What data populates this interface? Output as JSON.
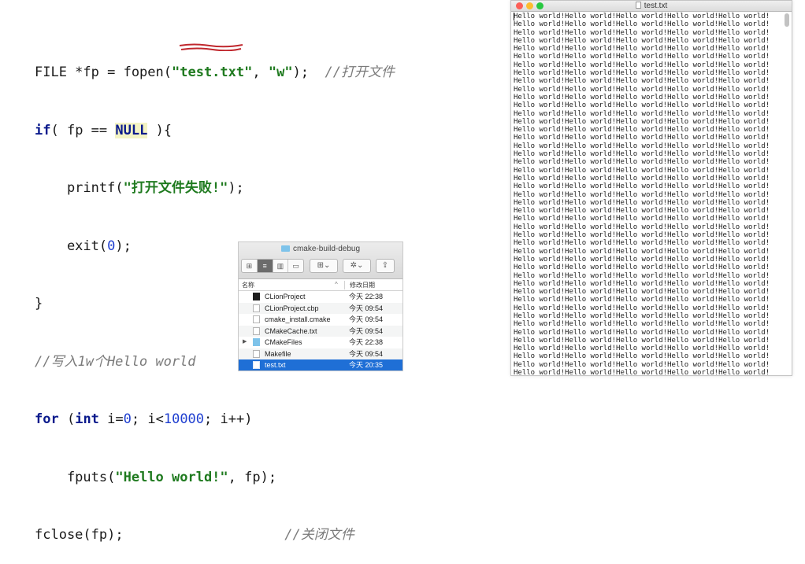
{
  "code": {
    "l1_pre": "FILE *fp = fopen(",
    "l1_file": "\"test.txt\"",
    "l1_mid": ", ",
    "l1_mode": "\"w\"",
    "l1_post": ");  ",
    "l1_comment": "//打开文件",
    "l2_if": "if",
    "l2_a": "( fp == ",
    "l2_null": "NULL",
    "l2_b": " ){",
    "l3_a": "    printf(",
    "l3_str": "\"打开文件失败!\"",
    "l3_b": ");",
    "l4_a": "    exit(",
    "l4_num": "0",
    "l4_b": ");",
    "l5": "}",
    "l6_comment": "//写入1w个Hello world",
    "l7_for": "for",
    "l7_a": " (",
    "l7_int": "int",
    "l7_b": " i=",
    "l7_zero": "0",
    "l7_c": "; i<",
    "l7_max": "10000",
    "l7_d": "; i++)",
    "l8_a": "    fputs(",
    "l8_str": "\"Hello world!\"",
    "l8_b": ", fp);",
    "l9_a": "fclose(fp);                    ",
    "l9_comment": "//关闭文件"
  },
  "finder": {
    "title": "cmake-build-debug",
    "view_buttons": [
      "⊞",
      "≡",
      "▥",
      "▭"
    ],
    "arrange_label": "⊞⌄",
    "action_label": "✲⌄",
    "share_label": "⇪",
    "col_name": "名称",
    "col_sort": "^",
    "col_date": "修改日期",
    "rows": [
      {
        "name": "CLionProject",
        "date": "今天 22:38",
        "icon": "executable-icon",
        "disclosure": ""
      },
      {
        "name": "CLionProject.cbp",
        "date": "今天 09:54",
        "icon": "document-icon",
        "disclosure": ""
      },
      {
        "name": "cmake_install.cmake",
        "date": "今天 09:54",
        "icon": "document-icon",
        "disclosure": ""
      },
      {
        "name": "CMakeCache.txt",
        "date": "今天 09:54",
        "icon": "document-icon",
        "disclosure": ""
      },
      {
        "name": "CMakeFiles",
        "date": "今天 22:38",
        "icon": "folder-icon",
        "disclosure": "▶"
      },
      {
        "name": "Makefile",
        "date": "今天 09:54",
        "icon": "document-icon",
        "disclosure": ""
      },
      {
        "name": "test.txt",
        "date": "今天 20:35",
        "icon": "document-icon",
        "disclosure": ""
      }
    ],
    "selected_row": "test.txt"
  },
  "textedit": {
    "title": "test.txt",
    "repeat_text": "Hello world!",
    "visible_lines": 46,
    "per_line": 5
  },
  "colors": {
    "keyword": "#0a1a8c",
    "string": "#1f7a1f",
    "number": "#1f3fd0",
    "comment": "#7a7a7a",
    "selection": "#1f6fd6"
  }
}
